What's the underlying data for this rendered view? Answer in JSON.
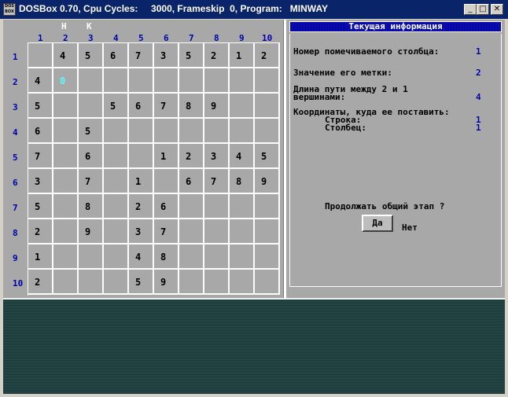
{
  "window": {
    "icon_text": "DOS BOX",
    "title": "DOSBox 0.70, Cpu Cycles:     3000, Frameskip  0, Program:   MINWAY",
    "minimize_label": "_",
    "maximize_label": "□",
    "close_label": "✕"
  },
  "board": {
    "marks": [
      "Н",
      "К"
    ],
    "col_headers": [
      "1",
      "2",
      "3",
      "4",
      "5",
      "6",
      "7",
      "8",
      "9",
      "10"
    ],
    "row_headers": [
      "1",
      "2",
      "3",
      "4",
      "5",
      "6",
      "7",
      "8",
      "9",
      "10"
    ],
    "cells": [
      [
        "",
        "4",
        "5",
        "6",
        "7",
        "3",
        "5",
        "2",
        "1",
        "2"
      ],
      [
        "4",
        "0",
        "",
        "",
        "",
        "",
        "",
        "",
        "",
        ""
      ],
      [
        "5",
        "",
        "",
        "5",
        "6",
        "7",
        "8",
        "9",
        "",
        ""
      ],
      [
        "6",
        "",
        "5",
        "",
        "",
        "",
        "",
        "",
        "",
        ""
      ],
      [
        "7",
        "",
        "6",
        "",
        "",
        "1",
        "2",
        "3",
        "4",
        "5"
      ],
      [
        "3",
        "",
        "7",
        "",
        "1",
        "",
        "6",
        "7",
        "8",
        "9"
      ],
      [
        "5",
        "",
        "8",
        "",
        "2",
        "6",
        "",
        "",
        "",
        ""
      ],
      [
        "2",
        "",
        "9",
        "",
        "3",
        "7",
        "",
        "",
        "",
        ""
      ],
      [
        "1",
        "",
        "",
        "",
        "4",
        "8",
        "",
        "",
        "",
        ""
      ],
      [
        "2",
        "",
        "",
        "",
        "5",
        "9",
        "",
        "",
        "",
        ""
      ]
    ],
    "current_cell": {
      "row": 2,
      "col": 2
    }
  },
  "info": {
    "heading": "Текущая информация",
    "col_label": "Номер помечиваемого столбца:",
    "col_value": "1",
    "mark_label": "Значение его метки:",
    "mark_value": "2",
    "path_label_1": "Длина пути между 2 и 1",
    "path_label_2": "вершинами:",
    "path_value": "4",
    "coords_label": "Координаты, куда ее поставить:",
    "row_label": "Строка:",
    "row_value": "1",
    "col2_label": "Столбец:",
    "col2_value": "1",
    "question": "Продолжать общий этап ?",
    "yes_label": "Да",
    "no_label": "Нет"
  }
}
